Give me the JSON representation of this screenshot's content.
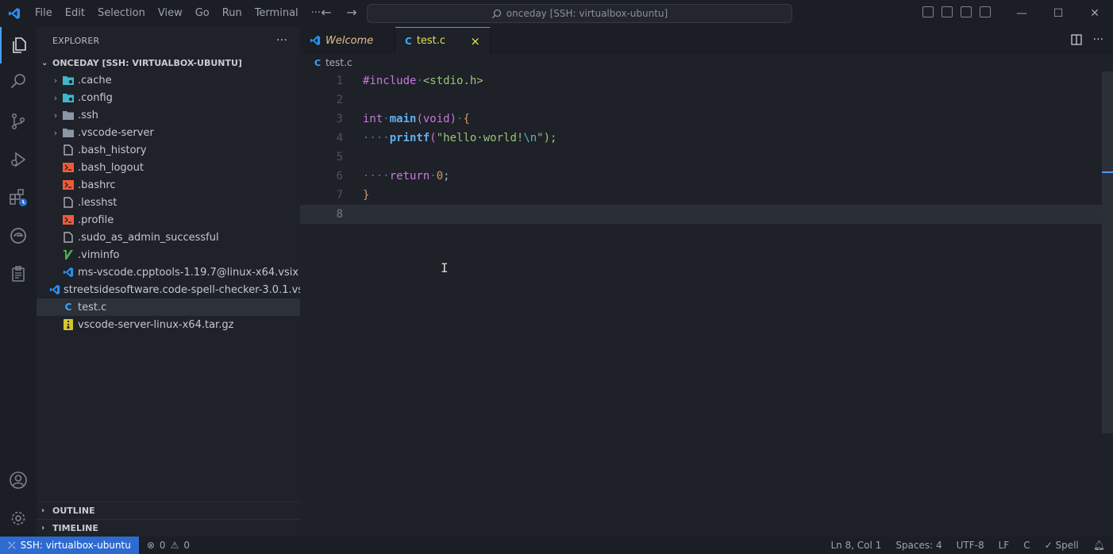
{
  "titlebar": {
    "menu": [
      "File",
      "Edit",
      "Selection",
      "View",
      "Go",
      "Run",
      "Terminal",
      "···"
    ],
    "search_text": "onceday [SSH: virtualbox-ubuntu]"
  },
  "sidebar": {
    "title": "EXPLORER",
    "more": "···",
    "folder": "ONCEDAY [SSH: VIRTUALBOX-UBUNTU]",
    "items": [
      {
        "label": ".cache",
        "icon": "folder-gear-icon",
        "color": "#3fb6c9",
        "chevron": true
      },
      {
        "label": ".config",
        "icon": "folder-gear-icon",
        "color": "#3fb6c9",
        "chevron": true
      },
      {
        "label": ".ssh",
        "icon": "folder-icon",
        "color": "#8c97a5",
        "chevron": true
      },
      {
        "label": ".vscode-server",
        "icon": "folder-icon",
        "color": "#8c97a5",
        "chevron": true
      },
      {
        "label": ".bash_history",
        "icon": "file-icon",
        "color": "#c5c8ce",
        "chevron": false
      },
      {
        "label": ".bash_logout",
        "icon": "shell-icon",
        "color": "#f05a3a",
        "chevron": false
      },
      {
        "label": ".bashrc",
        "icon": "shell-icon",
        "color": "#f05a3a",
        "chevron": false
      },
      {
        "label": ".lesshst",
        "icon": "file-icon",
        "color": "#c5c8ce",
        "chevron": false
      },
      {
        "label": ".profile",
        "icon": "shell-icon",
        "color": "#f05a3a",
        "chevron": false
      },
      {
        "label": ".sudo_as_admin_successful",
        "icon": "file-icon",
        "color": "#c5c8ce",
        "chevron": false
      },
      {
        "label": ".viminfo",
        "icon": "vim-icon",
        "color": "#4caf50",
        "chevron": false
      },
      {
        "label": "ms-vscode.cpptools-1.19.7@linux-x64.vsix",
        "icon": "vsix-icon",
        "color": "#2b8ff0",
        "chevron": false
      },
      {
        "label": "streetsidesoftware.code-spell-checker-3.0.1.vsix",
        "icon": "vsix-icon",
        "color": "#2b8ff0",
        "chevron": false
      },
      {
        "label": "test.c",
        "icon": "c-file-icon",
        "color": "#3fa7ff",
        "chevron": false
      },
      {
        "label": "vscode-server-linux-x64.tar.gz",
        "icon": "archive-icon",
        "color": "#d6c42f",
        "chevron": false
      }
    ],
    "outline": "OUTLINE",
    "timeline": "TIMELINE"
  },
  "tabs": [
    {
      "label": "Welcome",
      "icon": "vscode-icon"
    },
    {
      "label": "test.c",
      "icon": "c-file-icon",
      "close": "×"
    }
  ],
  "breadcrumb": "test.c",
  "code": {
    "line_numbers": [
      "1",
      "2",
      "3",
      "4",
      "5",
      "6",
      "7",
      "8"
    ],
    "include": "#include",
    "header": "<stdio.h>",
    "int": "int",
    "main": "main",
    "void": "(void)",
    "open_brace": "{",
    "printf": "printf",
    "str_a": "\"hello·world!",
    "str_esc": "\\n",
    "str_b": "\");",
    "return": "return",
    "zero": "0",
    "semi": ";",
    "close_brace": "}"
  },
  "statusbar": {
    "remote": "SSH: virtualbox-ubuntu",
    "errors": "0",
    "warnings": "0",
    "position": "Ln 8, Col 1",
    "spaces": "Spaces: 4",
    "encoding": "UTF-8",
    "eol": "LF",
    "language": "C",
    "spell": "Spell"
  }
}
